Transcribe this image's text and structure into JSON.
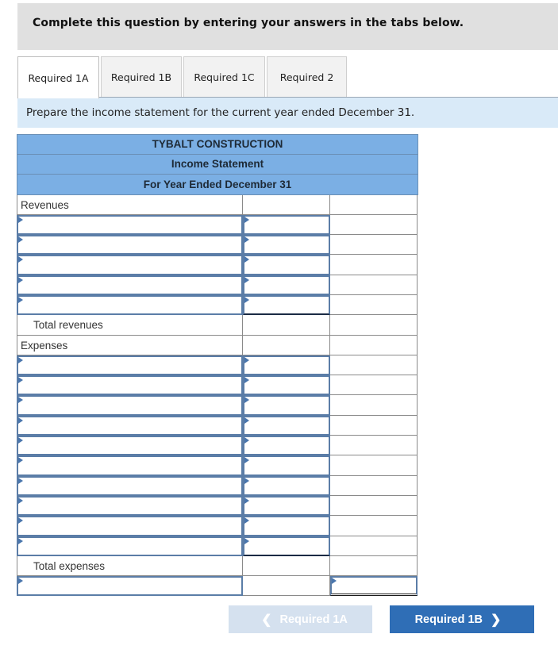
{
  "banner": {
    "text": "Complete this question by entering your answers in the tabs below."
  },
  "tabs": [
    {
      "label": "Required 1A",
      "active": true
    },
    {
      "label": "Required 1B",
      "active": false
    },
    {
      "label": "Required 1C",
      "active": false
    },
    {
      "label": "Required 2",
      "active": false
    }
  ],
  "instruction": "Prepare the income statement for the current year ended December 31.",
  "statement": {
    "company": "TYBALT CONSTRUCTION",
    "title": "Income Statement",
    "period": "For Year Ended December 31",
    "revenues_label": "Revenues",
    "revenue_rows": [
      {
        "account": "",
        "amount": ""
      },
      {
        "account": "",
        "amount": ""
      },
      {
        "account": "",
        "amount": ""
      },
      {
        "account": "",
        "amount": ""
      },
      {
        "account": "",
        "amount": ""
      }
    ],
    "total_revenues_label": "Total revenues",
    "total_revenues_value": "",
    "expenses_label": "Expenses",
    "expense_rows": [
      {
        "account": "",
        "amount": ""
      },
      {
        "account": "",
        "amount": ""
      },
      {
        "account": "",
        "amount": ""
      },
      {
        "account": "",
        "amount": ""
      },
      {
        "account": "",
        "amount": ""
      },
      {
        "account": "",
        "amount": ""
      },
      {
        "account": "",
        "amount": ""
      },
      {
        "account": "",
        "amount": ""
      },
      {
        "account": "",
        "amount": ""
      },
      {
        "account": "",
        "amount": ""
      }
    ],
    "total_expenses_label": "Total expenses",
    "total_expenses_value": "",
    "final_row": {
      "account": "",
      "amount": ""
    }
  },
  "nav": {
    "prev_label": "Required 1A",
    "next_label": "Required 1B",
    "prev_icon": "chevron-left-icon",
    "next_icon": "chevron-right-icon"
  },
  "colors": {
    "header_fill": "#7bafe4",
    "input_border": "#5b7da7",
    "next_button": "#2f6eb6",
    "prev_button_disabled": "#d5e1ef",
    "instruction_bg": "#d9eaf8"
  }
}
